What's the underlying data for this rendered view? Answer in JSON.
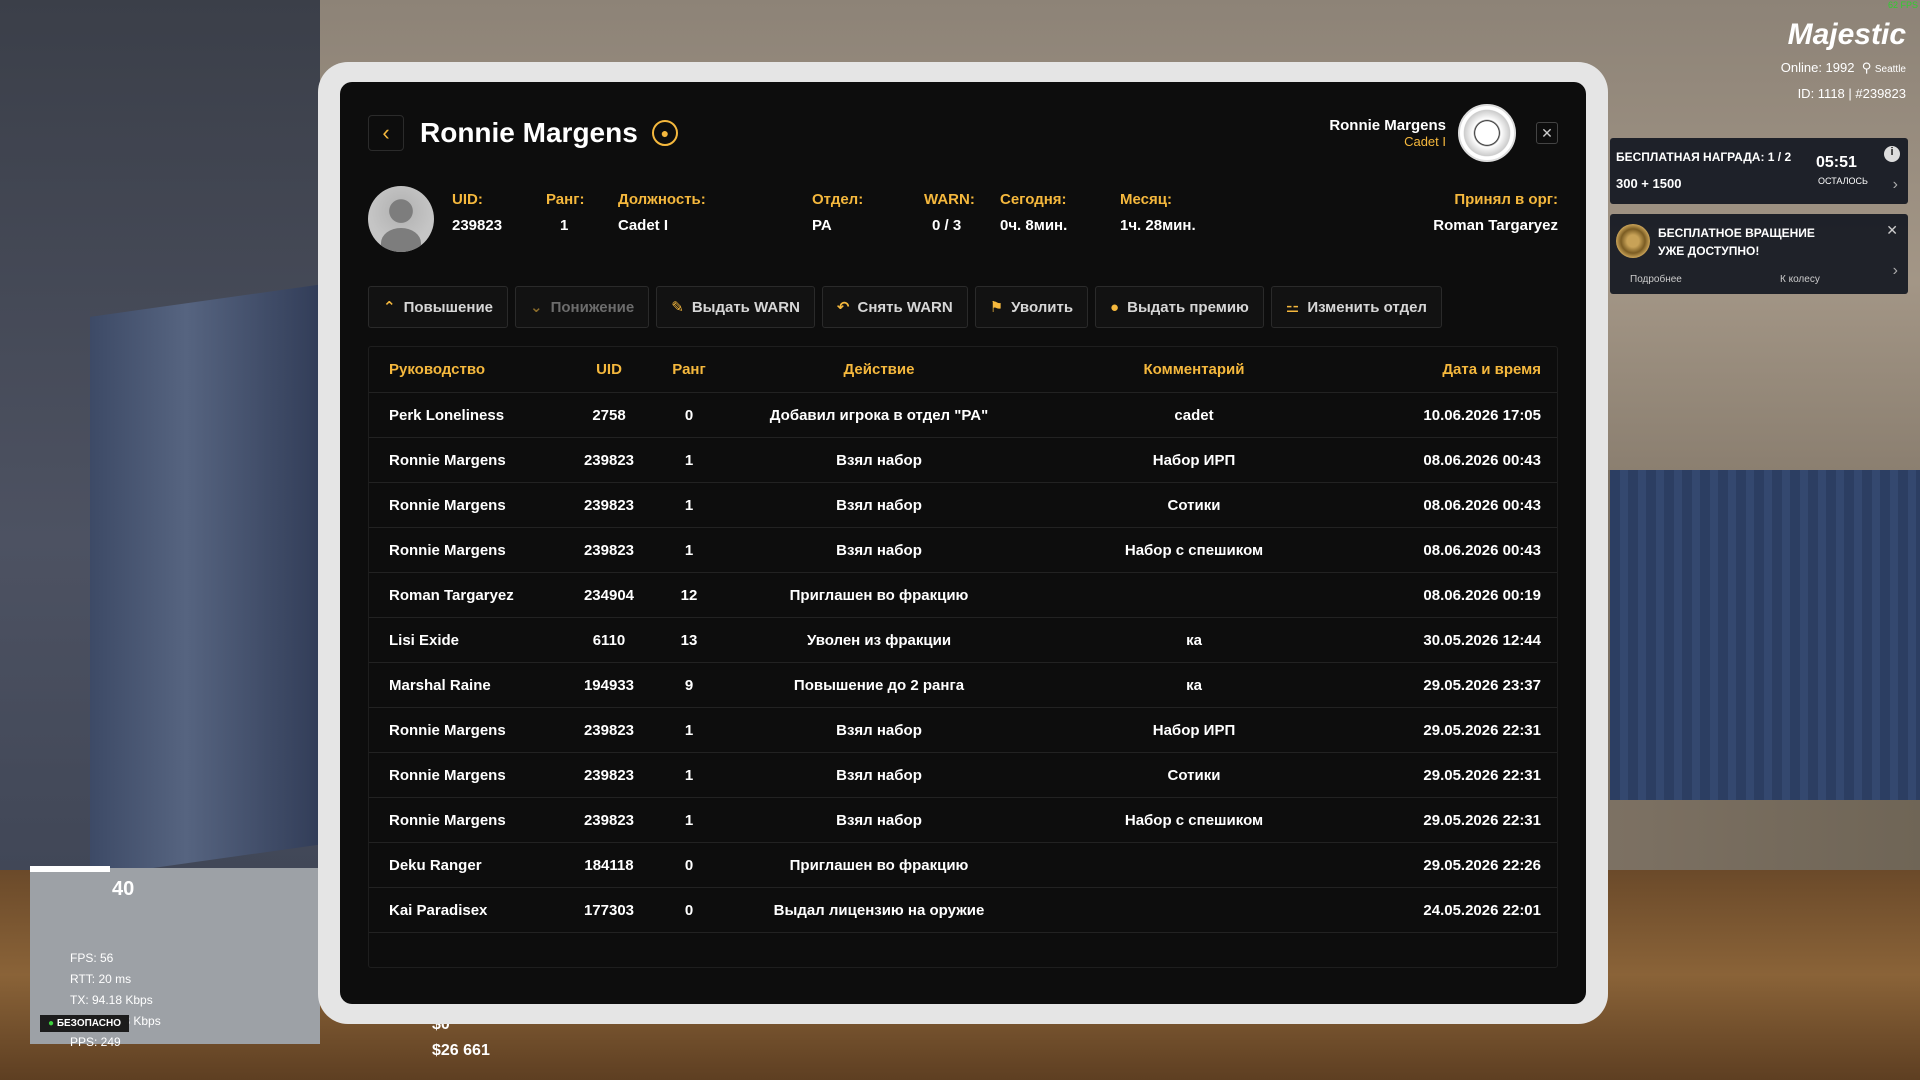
{
  "player": {
    "name": "Ronnie Margens",
    "rank_title": "Cadet I"
  },
  "info": {
    "uid": {
      "label": "UID:",
      "value": "239823"
    },
    "rank": {
      "label": "Ранг:",
      "value": "1"
    },
    "position": {
      "label": "Должность:",
      "value": "Cadet I"
    },
    "department": {
      "label": "Отдел:",
      "value": "PA"
    },
    "warn": {
      "label": "WARN:",
      "value": "0 / 3"
    },
    "today": {
      "label": "Сегодня:",
      "value": "0ч. 8мин."
    },
    "month": {
      "label": "Месяц:",
      "value": "1ч. 28мин."
    },
    "accepted": {
      "label": "Принял в орг:",
      "value": "Roman Targaryez"
    }
  },
  "actions": [
    {
      "label": "Повышение",
      "icon": "chevron-up-icon"
    },
    {
      "label": "Понижение",
      "icon": "chevron-down-icon"
    },
    {
      "label": "Выдать WARN",
      "icon": "warn-icon"
    },
    {
      "label": "Снять WARN",
      "icon": "undo-icon"
    },
    {
      "label": "Уволить",
      "icon": "fire-user-icon"
    },
    {
      "label": "Выдать премию",
      "icon": "coin-icon"
    },
    {
      "label": "Изменить отдел",
      "icon": "org-icon"
    }
  ],
  "table": {
    "headers": [
      "Руководство",
      "UID",
      "Ранг",
      "Действие",
      "Комментарий",
      "Дата и время"
    ],
    "rows": [
      [
        "Perk Loneliness",
        "2758",
        "0",
        "Добавил игрока в отдел \"PA\"",
        "cadet",
        "10.06.2026 17:05"
      ],
      [
        "Ronnie Margens",
        "239823",
        "1",
        "Взял набор",
        "Набор ИРП",
        "08.06.2026 00:43"
      ],
      [
        "Ronnie Margens",
        "239823",
        "1",
        "Взял набор",
        "Сотики",
        "08.06.2026 00:43"
      ],
      [
        "Ronnie Margens",
        "239823",
        "1",
        "Взял набор",
        "Набор с спешиком",
        "08.06.2026 00:43"
      ],
      [
        "Roman Targaryez",
        "234904",
        "12",
        "Приглашен во фракцию",
        "",
        "08.06.2026 00:19"
      ],
      [
        "Lisi Exide",
        "6110",
        "13",
        "Уволен из фракции",
        "ка",
        "30.05.2026 12:44"
      ],
      [
        "Marshal Raine",
        "194933",
        "9",
        "Повышение до 2 ранга",
        "ка",
        "29.05.2026 23:37"
      ],
      [
        "Ronnie Margens",
        "239823",
        "1",
        "Взял набор",
        "Набор ИРП",
        "29.05.2026 22:31"
      ],
      [
        "Ronnie Margens",
        "239823",
        "1",
        "Взял набор",
        "Сотики",
        "29.05.2026 22:31"
      ],
      [
        "Ronnie Margens",
        "239823",
        "1",
        "Взял набор",
        "Набор с спешиком",
        "29.05.2026 22:31"
      ],
      [
        "Deku Ranger",
        "184118",
        "0",
        "Приглашен во фракцию",
        "",
        "29.05.2026 22:26"
      ],
      [
        "Kai Paradisex",
        "177303",
        "0",
        "Выдал лицензию на оружие",
        "",
        "24.05.2026 22:01"
      ]
    ]
  },
  "hud": {
    "fps_top": "62 FPS",
    "logo": "Majestic",
    "online": "Online: 1992",
    "city": "Seattle",
    "id": "ID: 1118 | #239823",
    "reward_title": "БЕСПЛАТНАЯ НАГРАДА: 1 / 2",
    "reward_amount": "300 + 1500",
    "timer": "05:51",
    "timer_label": "ОСТАЛОСЬ",
    "spin_title": "БЕСПЛАТНОЕ ВРАЩЕНИЕ УЖЕ ДОСТУПНО!",
    "spin_more": "Подробнее",
    "spin_wheel": "К колесу",
    "speed": "40",
    "fps": "FPS: 56",
    "rtt": "RTT: 20 ms",
    "tx": "TX: 94.18 Kbps",
    "rx": "RX: 364.23 Kbps",
    "pps": "PPS: 249",
    "safe": "БЕЗОПАСНО",
    "cash": "$0",
    "bank": "$26 661"
  }
}
